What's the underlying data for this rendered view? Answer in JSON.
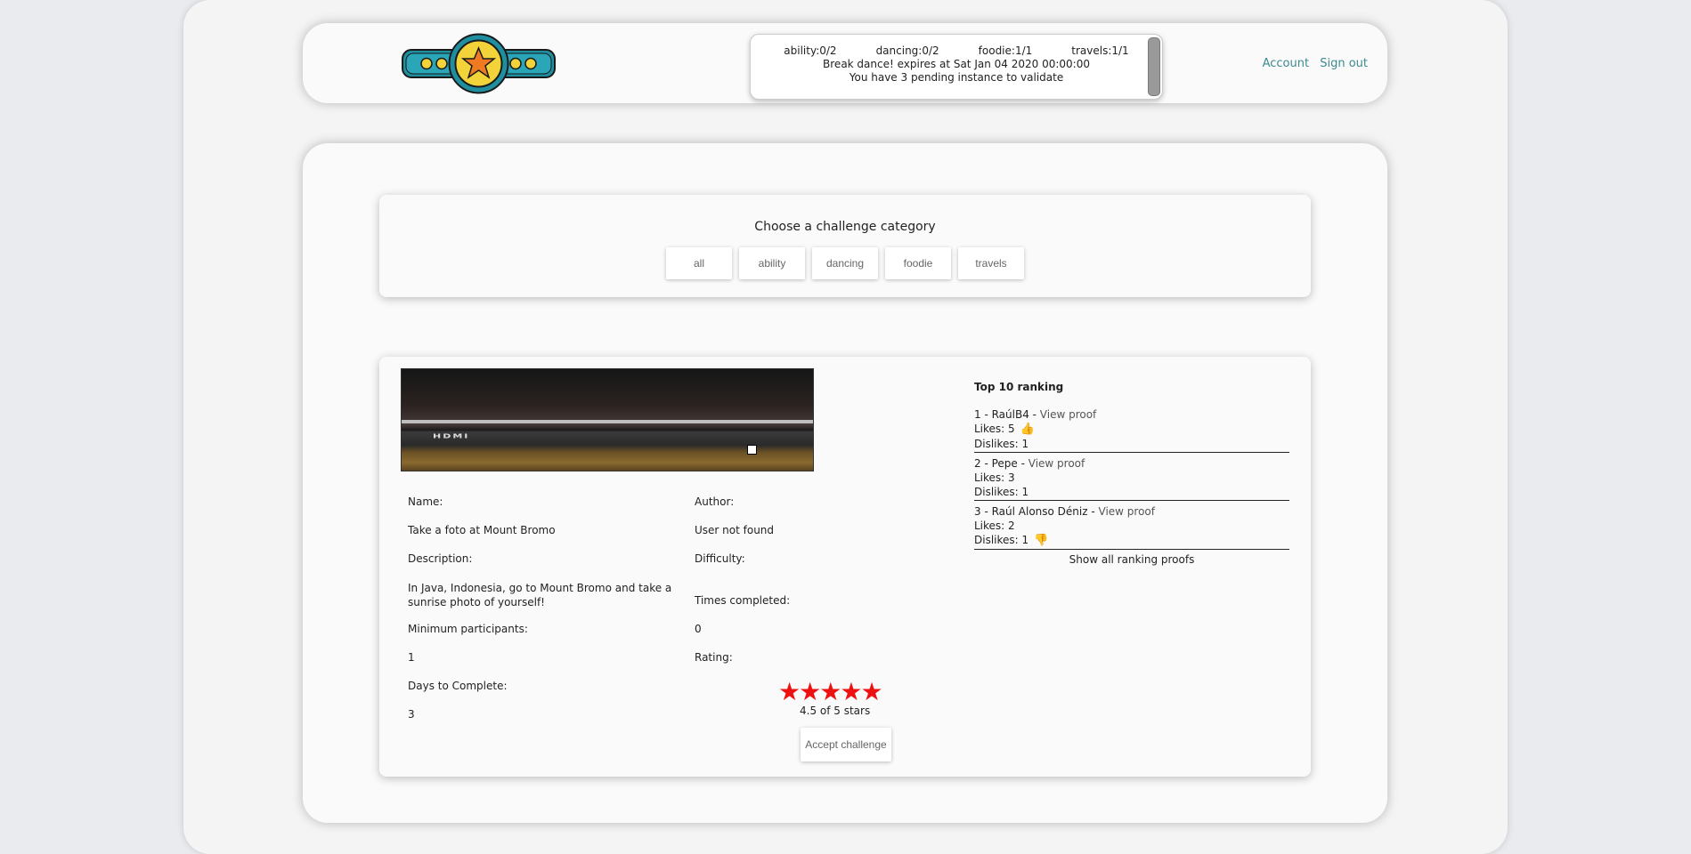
{
  "header": {
    "counts": [
      {
        "label": "ability:0/2"
      },
      {
        "label": "dancing:0/2"
      },
      {
        "label": "foodie:1/1"
      },
      {
        "label": "travels:1/1"
      }
    ],
    "expiry_line": "Break dance! expires at Sat Jan 04 2020 00:00:00",
    "pending_line": "You have 3 pending instance to validate",
    "nav": {
      "account": "Account",
      "sign_out": "Sign out"
    }
  },
  "categories": {
    "title": "Choose a challenge category",
    "buttons": [
      "all",
      "ability",
      "dancing",
      "foodie",
      "travels"
    ]
  },
  "challenge": {
    "photo_text": "HDMI",
    "name_label": "Name:",
    "name_value": "Take a foto at Mount Bromo",
    "description_label": "Description:",
    "description_value": "In Java, Indonesia, go to Mount Bromo and take a sunrise photo of yourself!",
    "min_participants_label": "Minimum participants:",
    "min_participants_value": "1",
    "days_label": "Days to Complete:",
    "days_value": "3",
    "author_label": "Author:",
    "author_value": "User not found",
    "difficulty_label": "Difficulty:",
    "times_label": "Times completed:",
    "times_value": "0",
    "rating_label": "Rating:",
    "rating_stars": 5,
    "rating_text": "4.5 of 5 stars",
    "accept_label": "Accept challenge"
  },
  "ranking": {
    "title": "Top 10 ranking",
    "entries": [
      {
        "prefix": "1 - RaúlB4 - ",
        "link": "View proof",
        "likes": "Likes: 5",
        "dislikes": "Dislikes: 1",
        "likes_icon": "thumbs-up-icon"
      },
      {
        "prefix": "2 - Pepe - ",
        "link": "View proof",
        "likes": "Likes: 3",
        "dislikes": "Dislikes: 1"
      },
      {
        "prefix": "3 - Raúl Alonso Déniz - ",
        "link": "View proof",
        "likes": "Likes: 2",
        "dislikes": "Dislikes: 1",
        "dislikes_icon": "thumbs-down-icon"
      }
    ],
    "show_all": "Show all ranking proofs"
  }
}
